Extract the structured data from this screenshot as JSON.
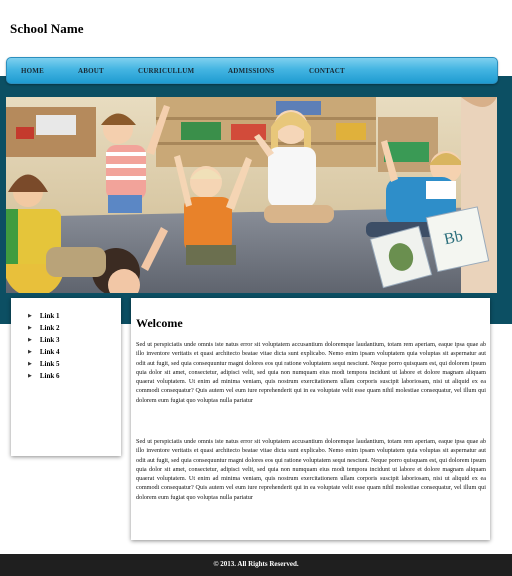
{
  "header": {
    "school_name": "School Name"
  },
  "nav": {
    "items": [
      {
        "label": "HOME"
      },
      {
        "label": "ABOUT"
      },
      {
        "label": "CURRICULLUM"
      },
      {
        "label": "ADMISSIONS"
      },
      {
        "label": "CONTACT"
      }
    ]
  },
  "hero": {
    "image_subject": "children raising hands in classroom"
  },
  "sidebar": {
    "links": [
      {
        "label": "Link 1"
      },
      {
        "label": "Link 2"
      },
      {
        "label": "Link 3"
      },
      {
        "label": "Link 4"
      },
      {
        "label": "Link 5"
      },
      {
        "label": "Link 6"
      }
    ]
  },
  "main": {
    "heading": "Welcome",
    "paragraphs": [
      "Sed ut perspiciatis unde omnis iste natus error sit voluptatem accusantium doloremque laudantium, totam rem aperiam, eaque ipsa quae ab illo inventore veritatis et quasi architecto beatae vitae dicta sunt explicabo. Nemo enim ipsam voluptatem quia voluptas sit aspernatur aut odit aut fugit, sed quia consequuntur magni dolores eos qui ratione voluptatem sequi nesciunt. Neque porro quisquam est, qui dolorem ipsum quia dolor sit amet, consectetur, adipisci velit, sed quia non numquam eius modi tempora incidunt ut labore et dolore magnam aliquam quaerat voluptatem. Ut enim ad minima veniam, quis nostrum exercitationem ullam corporis suscipit laboriosam, nisi ut aliquid ex ea commodi consequatur? Quis autem vel eum iure reprehenderit qui in ea voluptate velit esse quam nihil molestiae consequatur, vel illum qui dolorem eum fugiat quo voluptas nulla pariatur",
      "Sed ut perspiciatis unde omnis iste natus error sit voluptatem accusantium doloremque laudantium, totam rem aperiam, eaque ipsa quae ab illo inventore veritatis et quasi architecto beatae vitae dicta sunt explicabo. Nemo enim ipsam voluptatem quia voluptas sit aspernatur aut odit aut fugit, sed quia consequuntur magni dolores eos qui ratione voluptatem sequi nesciunt. Neque porro quisquam est, qui dolorem ipsum quia dolor sit amet, consectetur, adipisci velit, sed quia non numquam eius modi tempora incidunt ut labore et dolore magnam aliquam quaerat voluptatem. Ut enim ad minima veniam, quis nostrum exercitationem ullam corporis suscipit laboriosam, nisi ut aliquid ex ea commodi consequatur? Quis autem vel eum iure reprehenderit qui in ea voluptate velit esse quam nihil molestiae consequatur, vel illum qui dolorem eum fugiat quo voluptas nulla pariatur"
    ]
  },
  "footer": {
    "copyright": "© 2013. All Rights Reserved."
  },
  "colors": {
    "band": "#0c4f63",
    "nav_gradient_top": "#7fd0ef",
    "nav_gradient_bottom": "#1f9bd1",
    "footer": "#1f1f1f"
  }
}
